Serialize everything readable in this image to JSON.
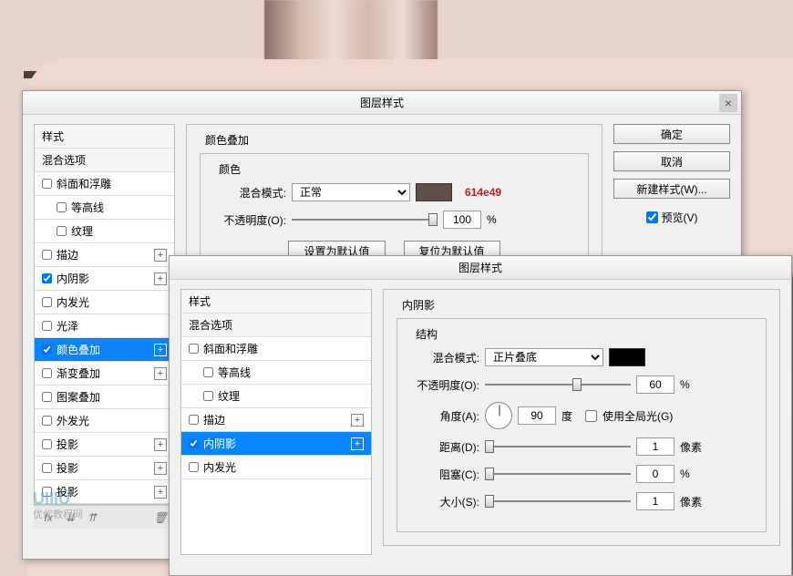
{
  "dialog1": {
    "title": "图层样式",
    "styles": [
      {
        "label": "样式",
        "type": "header"
      },
      {
        "label": "混合选项",
        "type": "header"
      },
      {
        "label": "斜面和浮雕",
        "checked": false
      },
      {
        "label": "等高线",
        "checked": false,
        "indent": true
      },
      {
        "label": "纹理",
        "checked": false,
        "indent": true
      },
      {
        "label": "描边",
        "checked": false,
        "plus": true
      },
      {
        "label": "内阴影",
        "checked": true,
        "plus": true
      },
      {
        "label": "内发光",
        "checked": false
      },
      {
        "label": "光泽",
        "checked": false
      },
      {
        "label": "颜色叠加",
        "checked": true,
        "selected": true,
        "plus": true
      },
      {
        "label": "渐变叠加",
        "checked": false,
        "plus": true
      },
      {
        "label": "图案叠加",
        "checked": false
      },
      {
        "label": "外发光",
        "checked": false
      },
      {
        "label": "投影",
        "checked": false,
        "plus": true
      },
      {
        "label": "投影",
        "checked": false,
        "plus": true
      },
      {
        "label": "投影",
        "checked": false,
        "plus": true
      }
    ],
    "panel": {
      "title": "颜色叠加",
      "subtitle": "颜色",
      "blend_mode_label": "混合模式:",
      "blend_mode_value": "正常",
      "color_hex": "614e49",
      "opacity_label": "不透明度(O):",
      "opacity_value": "100",
      "opacity_unit": "%",
      "set_default": "设置为默认值",
      "reset_default": "复位为默认值"
    },
    "buttons": {
      "ok": "确定",
      "cancel": "取消",
      "new_style": "新建样式(W)...",
      "preview": "预览(V)"
    }
  },
  "dialog2": {
    "title": "图层样式",
    "styles": [
      {
        "label": "样式",
        "type": "header"
      },
      {
        "label": "混合选项",
        "type": "header"
      },
      {
        "label": "斜面和浮雕",
        "checked": false
      },
      {
        "label": "等高线",
        "checked": false,
        "indent": true
      },
      {
        "label": "纹理",
        "checked": false,
        "indent": true
      },
      {
        "label": "描边",
        "checked": false,
        "plus": true
      },
      {
        "label": "内阴影",
        "checked": true,
        "selected": true,
        "plus": true
      },
      {
        "label": "内发光",
        "checked": false
      }
    ],
    "panel": {
      "title": "内阴影",
      "subtitle": "结构",
      "blend_mode_label": "混合模式:",
      "blend_mode_value": "正片叠底",
      "opacity_label": "不透明度(O):",
      "opacity_value": "60",
      "opacity_unit": "%",
      "angle_label": "角度(A):",
      "angle_value": "90",
      "angle_unit": "度",
      "global_light": "使用全局光(G)",
      "distance_label": "距离(D):",
      "distance_value": "1",
      "distance_unit": "像素",
      "choke_label": "阻塞(C):",
      "choke_value": "0",
      "choke_unit": "%",
      "size_label": "大小(S):",
      "size_value": "1",
      "size_unit": "像素"
    }
  },
  "watermark": {
    "main": "UIIIU",
    "sub": "优优教程网"
  }
}
